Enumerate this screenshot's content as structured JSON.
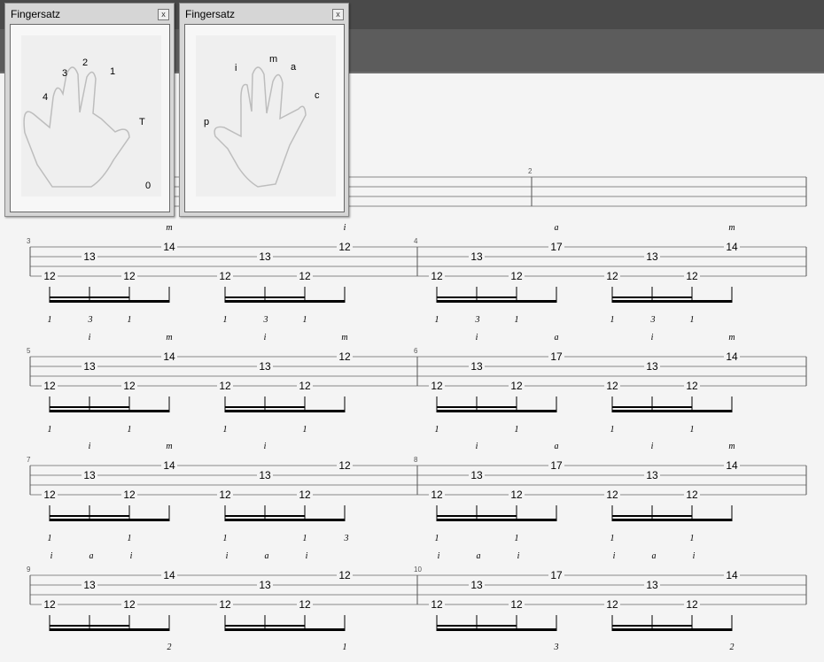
{
  "panels": [
    {
      "title": "Fingersatz",
      "close": "x",
      "labels": [
        "4",
        "3",
        "2",
        "1",
        "T",
        "0"
      ]
    },
    {
      "title": "Fingersatz",
      "close": "x",
      "labels": [
        "p",
        "i",
        "m",
        "a",
        "c"
      ]
    }
  ],
  "measure_numbers": [
    "2",
    "3",
    "4",
    "5",
    "6",
    "7",
    "8",
    "9",
    "10"
  ],
  "tab": {
    "beat_frets": [
      [
        "12",
        "13",
        "14",
        "12",
        "13",
        "12"
      ],
      [
        "12",
        "13",
        "17",
        "12",
        "13",
        "14"
      ],
      [
        "12",
        "13",
        "14",
        "12",
        "13",
        "12"
      ],
      [
        "12",
        "13",
        "17",
        "12",
        "13",
        "14"
      ],
      [
        "12",
        "13",
        "14",
        "12",
        "13",
        "12"
      ],
      [
        "12",
        "13",
        "17",
        "12",
        "13",
        "14"
      ],
      [
        "12",
        "13",
        "14",
        "12",
        "13",
        "12"
      ],
      [
        "12",
        "13",
        "17",
        "12",
        "13",
        "14"
      ]
    ],
    "right_hand": [
      [
        "",
        "",
        "m",
        "",
        "",
        "i"
      ],
      [
        "",
        "",
        "a",
        "",
        "",
        "m"
      ],
      [
        "",
        "i",
        "m",
        "",
        "i",
        "m"
      ],
      [
        "",
        "i",
        "a",
        "",
        "i",
        "m"
      ],
      [
        "",
        "i",
        "m",
        "",
        "i",
        ""
      ],
      [
        "",
        "i",
        "a",
        "",
        "i",
        "m"
      ],
      [
        "i",
        "a",
        "i",
        "i",
        "a",
        "i"
      ],
      [
        "i",
        "a",
        "i",
        "i",
        "a",
        "i"
      ]
    ],
    "left_hand": [
      [
        "1",
        "3",
        "1",
        "1",
        "3",
        "1"
      ],
      [
        "1",
        "3",
        "1",
        "1",
        "3",
        "1"
      ],
      [
        "1",
        "",
        "1",
        "1",
        "",
        "1"
      ],
      [
        "1",
        "",
        "1",
        "1",
        "",
        "1"
      ],
      [
        "1",
        "",
        "1",
        "1",
        "",
        "1",
        "3"
      ],
      [
        "1",
        "",
        "1",
        "1",
        "",
        "1"
      ],
      [
        "",
        "",
        "2",
        "",
        "",
        "1"
      ],
      [
        "",
        "",
        "3",
        "",
        "",
        "2"
      ]
    ]
  }
}
